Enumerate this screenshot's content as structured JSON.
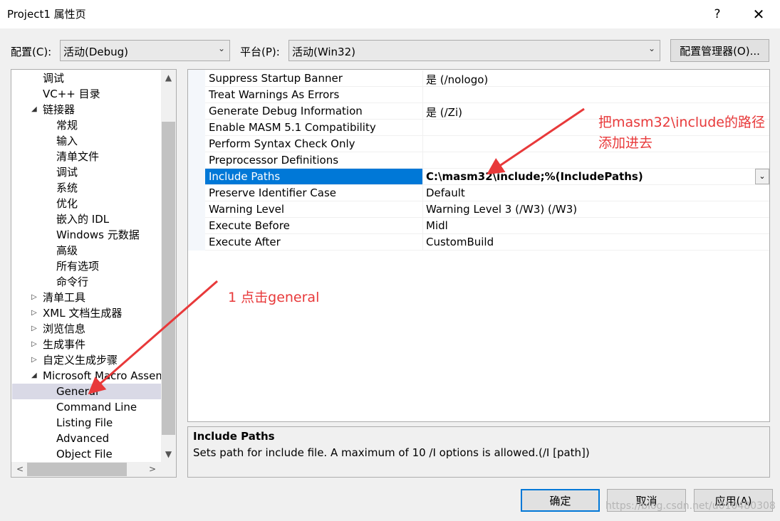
{
  "window": {
    "title": "Project1 属性页",
    "help": "?",
    "close": "✕"
  },
  "toolbar": {
    "config_label": "配置(C):",
    "config_value": "活动(Debug)",
    "platform_label": "平台(P):",
    "platform_value": "活动(Win32)",
    "config_manager": "配置管理器(O)..."
  },
  "tree": {
    "items": [
      {
        "label": "调试",
        "indent": 1,
        "expander": ""
      },
      {
        "label": "VC++ 目录",
        "indent": 1,
        "expander": ""
      },
      {
        "label": "链接器",
        "indent": 1,
        "expander": "expanded"
      },
      {
        "label": "常规",
        "indent": 2,
        "expander": ""
      },
      {
        "label": "输入",
        "indent": 2,
        "expander": ""
      },
      {
        "label": "清单文件",
        "indent": 2,
        "expander": ""
      },
      {
        "label": "调试",
        "indent": 2,
        "expander": ""
      },
      {
        "label": "系统",
        "indent": 2,
        "expander": ""
      },
      {
        "label": "优化",
        "indent": 2,
        "expander": ""
      },
      {
        "label": "嵌入的 IDL",
        "indent": 2,
        "expander": ""
      },
      {
        "label": "Windows 元数据",
        "indent": 2,
        "expander": ""
      },
      {
        "label": "高级",
        "indent": 2,
        "expander": ""
      },
      {
        "label": "所有选项",
        "indent": 2,
        "expander": ""
      },
      {
        "label": "命令行",
        "indent": 2,
        "expander": ""
      },
      {
        "label": "清单工具",
        "indent": 1,
        "expander": "collapsed"
      },
      {
        "label": "XML 文档生成器",
        "indent": 1,
        "expander": "collapsed"
      },
      {
        "label": "浏览信息",
        "indent": 1,
        "expander": "collapsed"
      },
      {
        "label": "生成事件",
        "indent": 1,
        "expander": "collapsed"
      },
      {
        "label": "自定义生成步骤",
        "indent": 1,
        "expander": "collapsed"
      },
      {
        "label": "Microsoft Macro Assembler",
        "indent": 1,
        "expander": "expanded"
      },
      {
        "label": "General",
        "indent": 2,
        "expander": "",
        "selected": true
      },
      {
        "label": "Command Line",
        "indent": 2,
        "expander": ""
      },
      {
        "label": "Listing File",
        "indent": 2,
        "expander": ""
      },
      {
        "label": "Advanced",
        "indent": 2,
        "expander": ""
      },
      {
        "label": "Object File",
        "indent": 2,
        "expander": ""
      }
    ]
  },
  "properties": [
    {
      "name": "Suppress Startup Banner",
      "value": "是 (/nologo)"
    },
    {
      "name": "Treat Warnings As Errors",
      "value": ""
    },
    {
      "name": "Generate Debug Information",
      "value": "是 (/Zi)"
    },
    {
      "name": "Enable MASM 5.1 Compatibility",
      "value": ""
    },
    {
      "name": "Perform Syntax Check Only",
      "value": ""
    },
    {
      "name": "Preprocessor Definitions",
      "value": ""
    },
    {
      "name": "Include Paths",
      "value": "C:\\masm32\\include;%(IncludePaths)",
      "selected": true
    },
    {
      "name": "Preserve Identifier Case",
      "value": "Default"
    },
    {
      "name": "Warning Level",
      "value": "Warning Level 3 (/W3) (/W3)"
    },
    {
      "name": "Execute Before",
      "value": "Midl"
    },
    {
      "name": "Execute After",
      "value": "CustomBuild"
    }
  ],
  "description": {
    "title": "Include Paths",
    "text": "Sets path for include file. A maximum of 10 /I options is allowed.",
    "syntax": "(/I [path])"
  },
  "buttons": {
    "ok": "确定",
    "cancel": "取消",
    "apply": "应用(A)"
  },
  "annotations": {
    "step1": "1 点击general",
    "step2_line1": "把masm32\\include的路径",
    "step2_line2": "添加进去",
    "color": "#e8393a"
  },
  "watermark": "https://blog.csdn.net/u010480308"
}
